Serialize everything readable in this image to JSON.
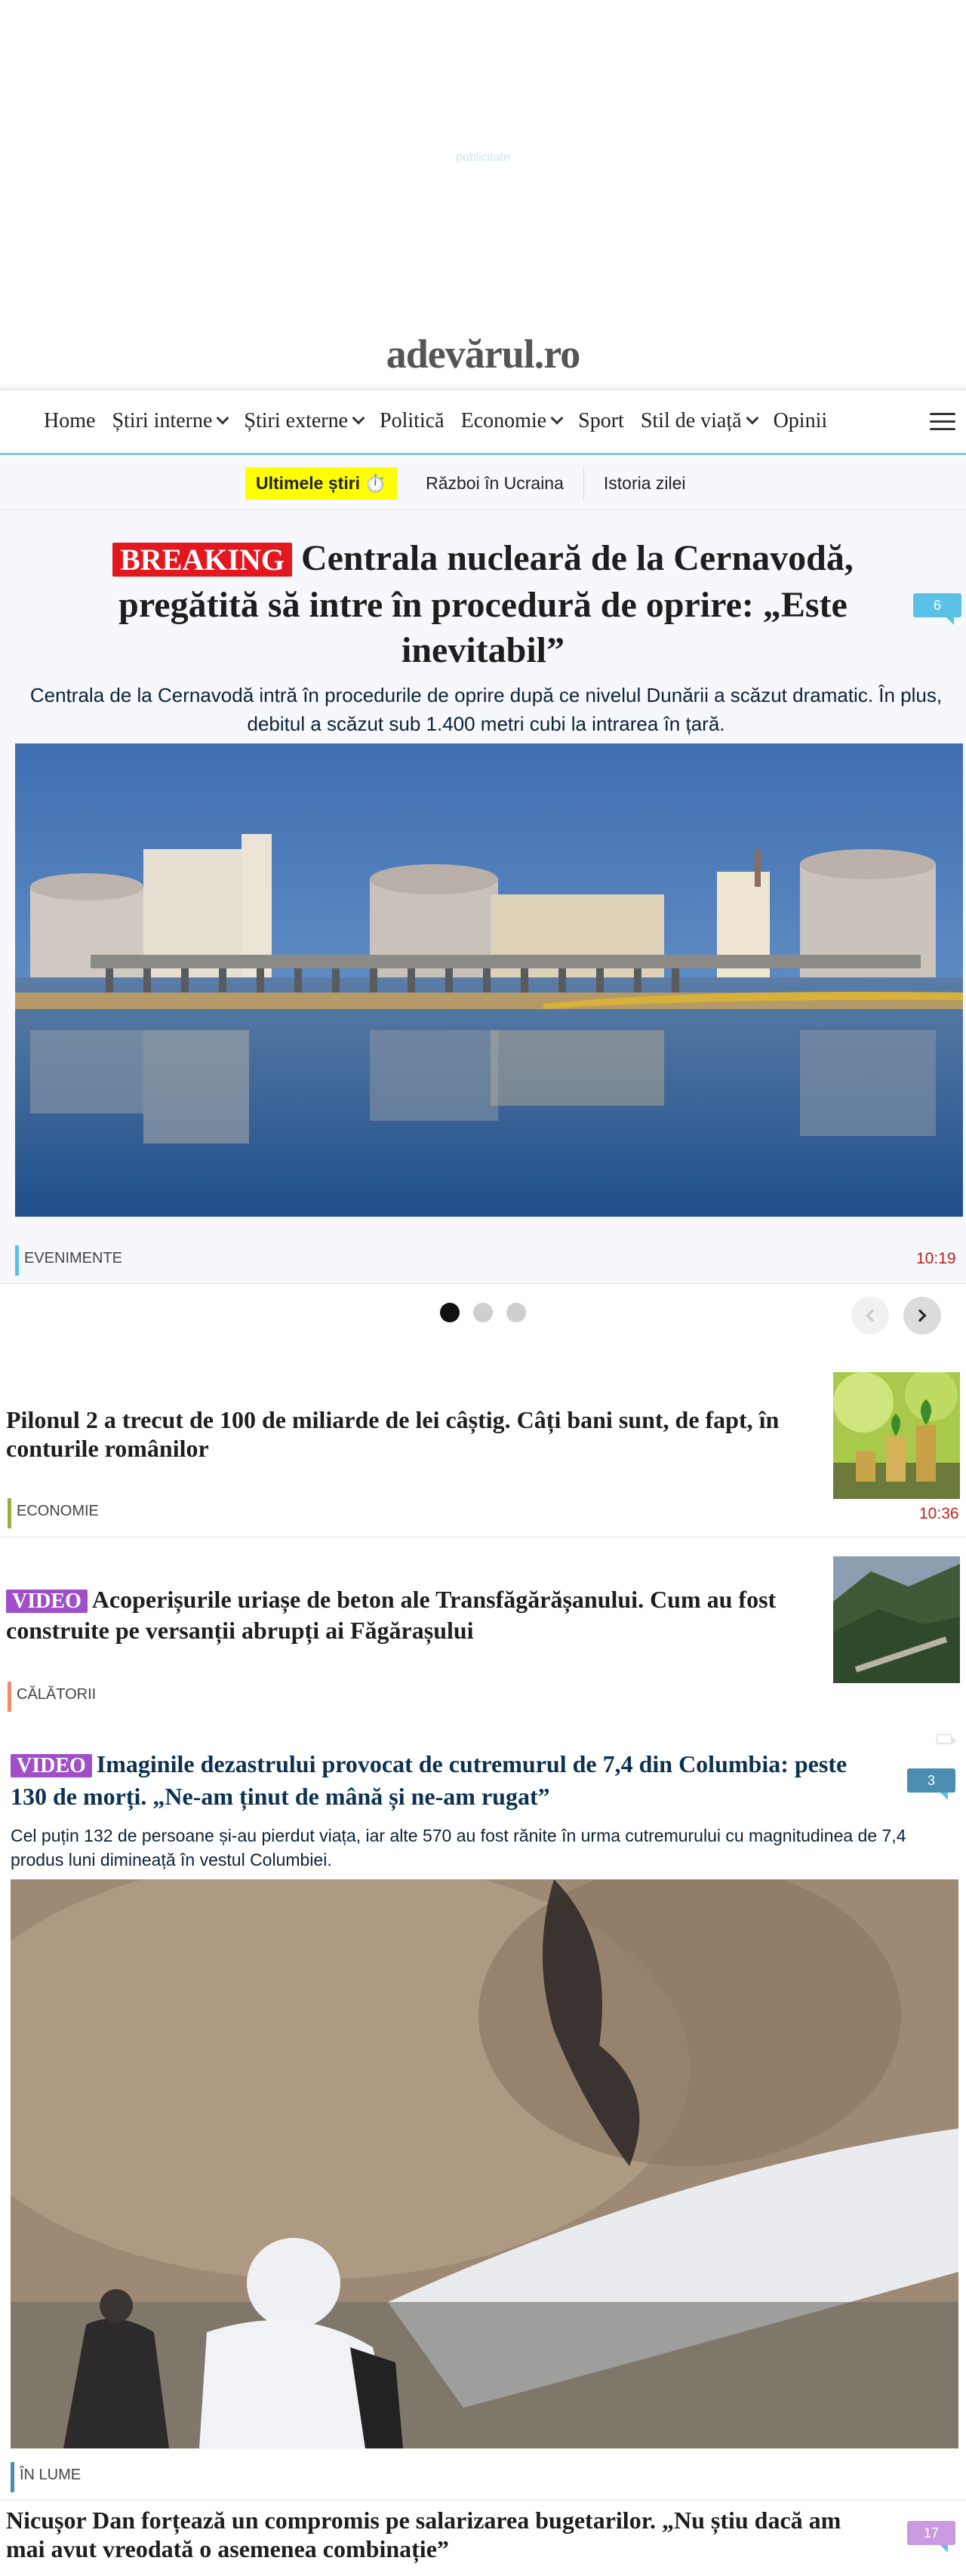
{
  "ad": {
    "label": "publicitate"
  },
  "logo": {
    "text": "adevărul.ro"
  },
  "nav": {
    "items": [
      {
        "label": "Home",
        "has_dropdown": false
      },
      {
        "label": "Știri interne",
        "has_dropdown": true
      },
      {
        "label": "Știri externe",
        "has_dropdown": true
      },
      {
        "label": "Politică",
        "has_dropdown": false
      },
      {
        "label": "Economie",
        "has_dropdown": true
      },
      {
        "label": "Sport",
        "has_dropdown": false
      },
      {
        "label": "Stil de viață",
        "has_dropdown": true
      },
      {
        "label": "Opinii",
        "has_dropdown": false
      }
    ],
    "menu_icon": "hamburger-menu-icon"
  },
  "subnav": {
    "highlight": "Ultimele știri ⏱️",
    "items": [
      "Război în Ucraina",
      "Istoria zilei"
    ]
  },
  "hero": {
    "badge": "BREAKING",
    "title": "Centrala nucleară de la Cernavodă, pregătită să intre în procedură de oprire: „Este inevitabil”",
    "comments": "6",
    "lead": "Centrala de la Cernavodă intră în procedurile de oprire după ce nivelul Dunării a scăzut dramatic. În plus, debitul a scăzut sub 1.400 metri cubi la intrarea în țară.",
    "category": "EVENIMENTE",
    "time": "10:19",
    "colors": {
      "sky": "#4d79b8",
      "water": "#2a5a94"
    }
  },
  "carousel": {
    "pages": 3,
    "active": 1
  },
  "articles": [
    {
      "title": "Pilonul 2 a trecut de 100 de miliarde de lei câștig. Câți bani sunt, de fapt, în conturile românilor",
      "category": "ECONOMIE",
      "time": "10:36"
    },
    {
      "badge": "VIDEO",
      "title": "Acoperișurile uriașe de beton ale Transfăgărășanului. Cum au fost construite pe versanții abrupți ai Făgărașului",
      "category": "CĂLĂTORII"
    }
  ],
  "feature": {
    "badge": "VIDEO",
    "title": "Imaginile dezastrului provocat de cutremurul de 7,4 din Columbia: peste 130 de morți. „Ne-am ținut de mână și ne-am rugat”",
    "comments": "3",
    "lead": "Cel puțin 132 de persoane și-au pierdut viața, iar alte 570 au fost rănite în urma cutremurului cu magnitudinea de 7,4 produs luni dimineață în vestul Columbiei.",
    "category": "ÎN LUME"
  },
  "last": {
    "title": "Nicușor Dan forțează un compromis pe salarizarea bugetarilor. „Nu știu dacă am mai avut vreodată o asemenea combinație”",
    "comments": "17"
  }
}
